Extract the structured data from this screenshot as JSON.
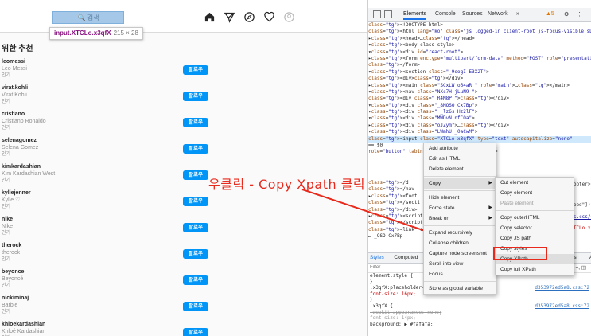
{
  "instagram": {
    "search_placeholder": "🔍 검색",
    "tooltip": {
      "selector": "input.XTCLo.x3qfX",
      "size": "215 × 28"
    },
    "nav_icons": [
      "home-icon",
      "direct-icon",
      "explore-icon",
      "activity-icon",
      "profile-icon"
    ],
    "section_title": "위한 추천",
    "follow_label": "팔로우",
    "suggestions": [
      {
        "username": "leomessi",
        "fullname": "Leo Messi",
        "tag": "인기"
      },
      {
        "username": "virat.kohli",
        "fullname": "Virat Kohli",
        "tag": "인기"
      },
      {
        "username": "cristiano",
        "fullname": "Cristiano Ronaldo",
        "tag": "인기"
      },
      {
        "username": "selenagomez",
        "fullname": "Selena Gomez",
        "tag": "인기"
      },
      {
        "username": "kimkardashian",
        "fullname": "Kim Kardashian West",
        "tag": "인기"
      },
      {
        "username": "kyliejenner",
        "fullname": "Kylie ♡",
        "tag": "인기"
      },
      {
        "username": "nike",
        "fullname": "Nike",
        "tag": "인기"
      },
      {
        "username": "therock",
        "fullname": "therock",
        "tag": "인기"
      },
      {
        "username": "beyonce",
        "fullname": "Beyoncé",
        "tag": "인기"
      },
      {
        "username": "nickiminaj",
        "fullname": "Barbie",
        "tag": "인기"
      },
      {
        "username": "khloekardashian",
        "fullname": "Khloé Kardashian",
        "tag": "인기"
      }
    ]
  },
  "annotation": {
    "text": "우클릭 - Copy Xpath 클릭",
    "color": "#e8291c"
  },
  "devtools": {
    "tabs": [
      "Elements",
      "Console",
      "Sources",
      "Network",
      "»"
    ],
    "warning_badge": "▲5",
    "tree_lines": [
      "<!DOCTYPE html>",
      "<html lang=\"ko\" class=\"js logged-in client-root js-focus-visible sDN5V\">",
      "  ▸<head>…</head>",
      "  ▾<body class style>",
      "    ▾<div id=\"react-root\">",
      "      ▸<form enctype=\"multipart/form-data\" method=\"POST\" role=\"presentation\">…",
      "       </form>",
      "      ▾<section class=\"_9eogI E3X2T\">",
      "         <div></div>",
      "        ▸<main class=\"SCxLW  o64aR \" role=\"main\">…</main>",
      "        ▾<nav class=\"NXc7H jLuN9  \">",
      "           <div class=\" R4M8P \"></div>",
      "          ▾<div class=\"_8MQSO  Cx7Bp\">",
      "            ▾<div class=\" _lz6s Hz2lF\">",
      "              ▾<div class=\"MWDvN nfCOa\">",
      "                ▸<div class=\"oJZym\">…</div>",
      "                ▾<div class=\"LWmhU _0aCwM\">",
      "                   <input class=\"XTCLo x3qfX\" type=\"text\" autocapitalize=\"none\"",
      "                   == $0",
      "                   role=\"button\" tabindex=\"0\">…</div>"
    ],
    "tree_lines_lower": [
      "            </d",
      "          </nav",
      "        ▸<foot",
      "         </secti",
      "       </div>",
      "      ▸<script",
      "       </script",
      "       <link re",
      "… _QSO.Cx7Bp"
    ],
    "tree_right_fragments": [
      "</footer>",
      "[\"feed\"]);",
      "mons.css/01aa",
      "x.XTCLo.x3qfX"
    ],
    "context_menu": [
      "Add attribute",
      "Edit as HTML",
      "Delete element",
      "Copy",
      "Hide element",
      "Force state",
      "Break on",
      "Expand recursively",
      "Collapse children",
      "Capture node screenshot",
      "Scroll into view",
      "Focus",
      "Store as global variable"
    ],
    "copy_submenu": [
      "Cut element",
      "Copy element",
      "Paste element",
      "Copy outerHTML",
      "Copy selector",
      "Copy JS path",
      "Copy styles",
      "Copy XPath",
      "Copy full XPath"
    ],
    "styles_tabs": [
      "Styles",
      "Computed",
      "Layout",
      "Event Listeners",
      "DOM Breakpoints",
      "Properties",
      "Accessibility"
    ],
    "styles_filter_placeholder": "Filter",
    "styles_right": ".cls  +, ◫",
    "style_rules": [
      {
        "sel": "element.style {",
        "src": ""
      },
      {
        "sel": "}",
        "src": ""
      },
      {
        "sel": ".x3qfX:placeholder-shown {",
        "src": "d353972ed5a8.css:72"
      },
      {
        "sel": "  font-size: 16px;",
        "src": ""
      },
      {
        "sel": "}",
        "src": ""
      },
      {
        "sel": ".x3qfX {",
        "src": "d353972ed5a8.css:72"
      },
      {
        "sel": "  -webkit-appearance: none;",
        "src": ""
      },
      {
        "sel": "  font-size: 14px;",
        "src": ""
      },
      {
        "sel": "  background: ▶ #fafafa;",
        "src": ""
      }
    ]
  }
}
